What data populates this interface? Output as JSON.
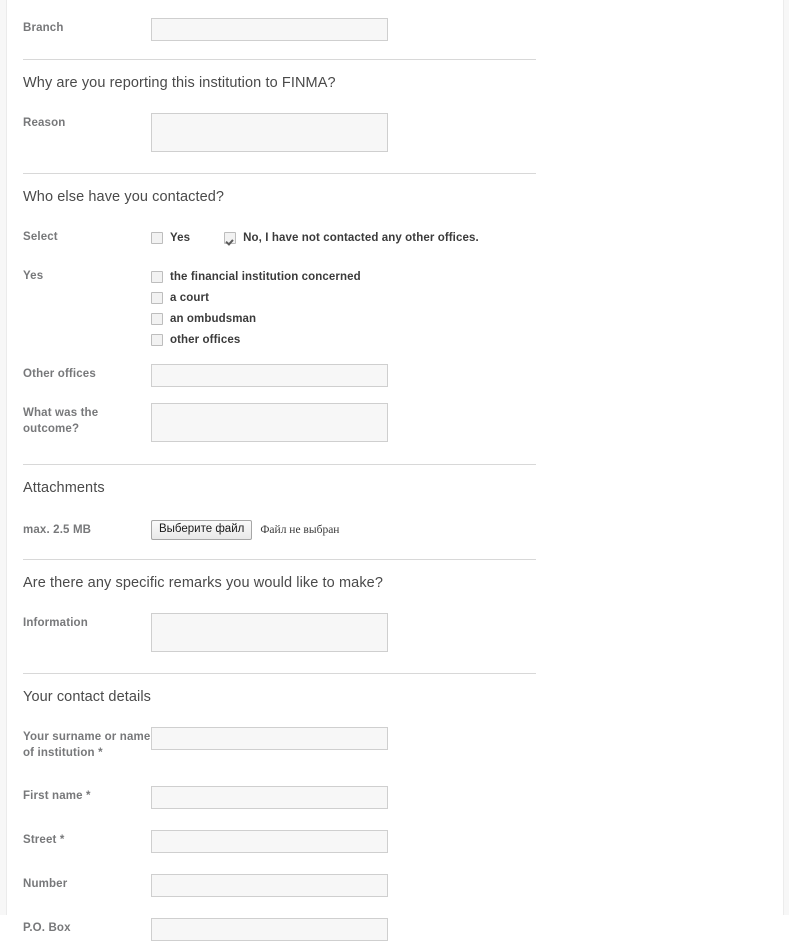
{
  "form": {
    "branch": {
      "label": "Branch",
      "value": "",
      "type": "text"
    },
    "section_reason": {
      "heading": "Why are you reporting this institution to FINMA?",
      "reason": {
        "label": "Reason",
        "value": "",
        "type": "textarea"
      }
    },
    "section_contacted": {
      "heading": "Who else have you contacted?",
      "select_label": "Select",
      "select_options": [
        {
          "label": "Yes",
          "checked": false
        },
        {
          "label": "No, I have not contacted any other offices.",
          "checked": true
        }
      ],
      "yes_label": "Yes",
      "yes_options": [
        {
          "label": "the financial institution concerned",
          "checked": false
        },
        {
          "label": "a court",
          "checked": false
        },
        {
          "label": "an ombudsman",
          "checked": false
        },
        {
          "label": "other offices",
          "checked": false
        }
      ],
      "other_offices": {
        "label": "Other offices",
        "value": "",
        "type": "text"
      },
      "outcome": {
        "label": "What was the outcome?",
        "value": "",
        "type": "textarea"
      }
    },
    "section_attachments": {
      "heading": "Attachments",
      "max_size_label": "max. 2.5 MB",
      "file_button_label": "Выберите файл",
      "file_status_text": "Файл не выбран"
    },
    "section_remarks": {
      "heading": "Are there any specific remarks you would like to make?",
      "information": {
        "label": "Information",
        "value": "",
        "type": "textarea"
      }
    },
    "section_contact": {
      "heading": "Your contact details",
      "fields": [
        {
          "label": "Your surname or name of institution *",
          "value": "",
          "type": "text"
        },
        {
          "label": "First name *",
          "value": "",
          "type": "text"
        },
        {
          "label": "Street *",
          "value": "",
          "type": "text"
        },
        {
          "label": "Number",
          "value": "",
          "type": "text"
        },
        {
          "label": "P.O. Box",
          "value": "",
          "type": "text"
        }
      ]
    }
  },
  "colors": {
    "page_background": "#ffffff",
    "field_background": "#f7f7f7",
    "field_border": "#cfcfcf",
    "label_text": "#77787a",
    "heading_text": "#4a4a4a",
    "separator": "#d8d8d8",
    "option_text": "#3b3b3b"
  }
}
